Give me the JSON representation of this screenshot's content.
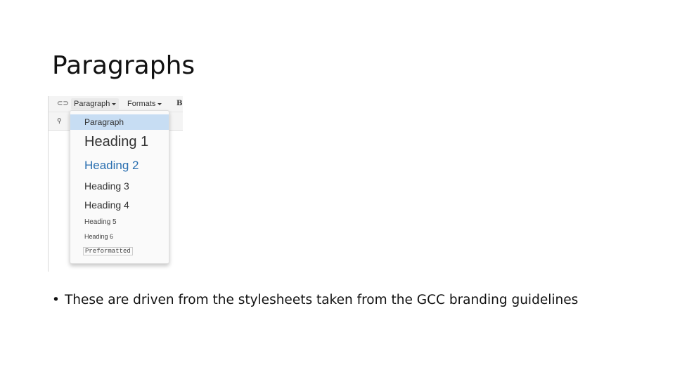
{
  "slide": {
    "title": "Paragraphs",
    "bullets": [
      "These are driven from the stylesheets taken from the GCC branding guidelines"
    ],
    "bullet_glyph": "•"
  },
  "editor_screenshot": {
    "toolbar": {
      "link_icon": "link-icon",
      "find_icon": "find-replace-icon",
      "paragraph_button": "Paragraph",
      "formats_button": "Formats",
      "bold_button": "B"
    },
    "format_menu": {
      "selected": "Paragraph",
      "items": [
        {
          "label": "Paragraph"
        },
        {
          "label": "Heading 1"
        },
        {
          "label": "Heading 2"
        },
        {
          "label": "Heading 3"
        },
        {
          "label": "Heading 4"
        },
        {
          "label": "Heading 5"
        },
        {
          "label": "Heading 6"
        },
        {
          "label": "Preformatted"
        }
      ]
    },
    "colors": {
      "selected_bg": "#c7ddf3",
      "heading2": "#2a6fb0",
      "text": "#333333"
    }
  }
}
